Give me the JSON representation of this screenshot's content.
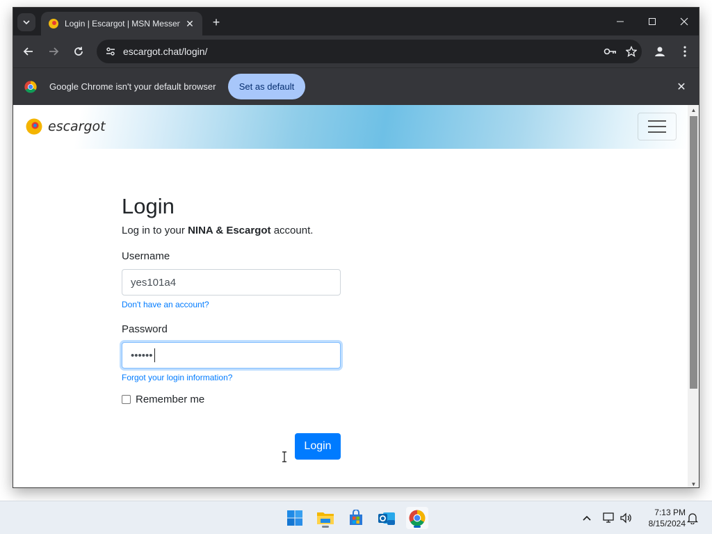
{
  "browser": {
    "tab_title": "Login | Escargot | MSN Messenger",
    "url": "escargot.chat/login/",
    "infobar_text": "Google Chrome isn't your default browser",
    "set_default_label": "Set as default"
  },
  "site": {
    "logo_text": "escargot"
  },
  "login": {
    "heading": "Login",
    "lead_prefix": "Log in to your ",
    "lead_bold": "NINA & Escargot",
    "lead_suffix": " account.",
    "username_label": "Username",
    "username_value": "yes101a4",
    "signup_link": "Don't have an account?",
    "password_label": "Password",
    "password_value": "••••••",
    "forgot_link": "Forgot your login information?",
    "remember_label": "Remember me",
    "submit_label": "Login"
  },
  "taskbar": {
    "time": "7:13 PM",
    "date": "8/15/2024"
  },
  "colors": {
    "accent": "#007bff",
    "chrome_dark": "#202124",
    "chip": "#a8c7fa"
  }
}
